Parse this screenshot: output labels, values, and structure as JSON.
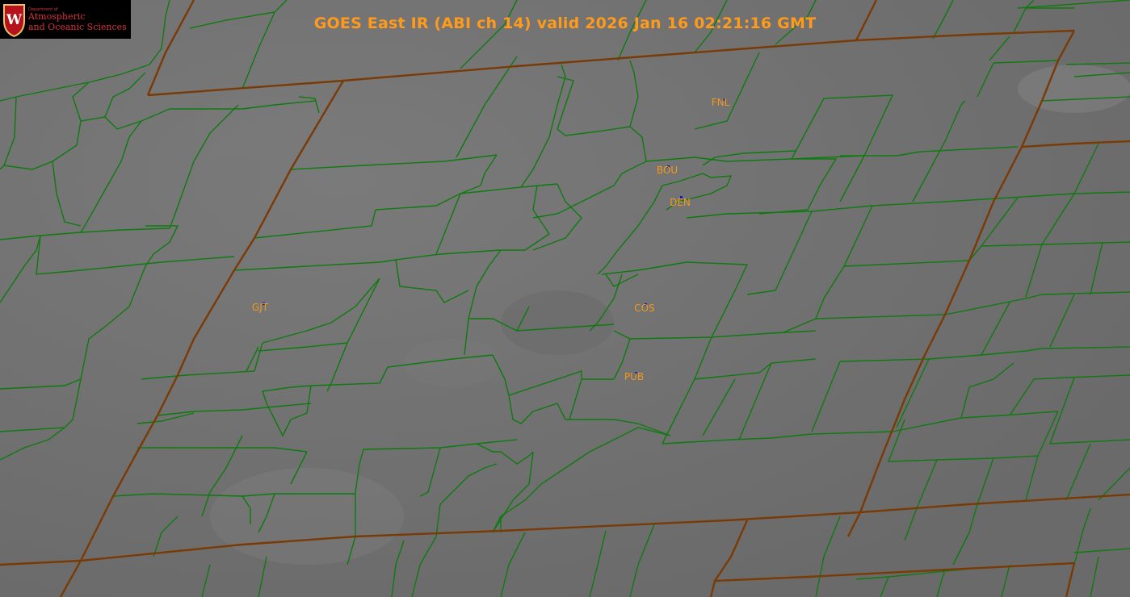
{
  "title": "GOES East IR (ABI ch 14) valid 2026 Jan 16 02:21:16 GMT",
  "logo": {
    "dept": "Department of",
    "line1": "Atmospheric",
    "line2": "and Oceanic Sciences",
    "crest_letter": "W"
  },
  "stations": [
    {
      "code": "FNL"
    },
    {
      "code": "BOU"
    },
    {
      "code": "DEN"
    },
    {
      "code": "GJT"
    },
    {
      "code": "COS"
    },
    {
      "code": "PUB"
    }
  ],
  "colors": {
    "background": "#6e6e6e",
    "state_border": "#8a3a00",
    "county_border": "#0f7a0f",
    "title": "#ff9a1a",
    "station_label": "#f39a1c",
    "station_marker": "#1a1aa8"
  }
}
